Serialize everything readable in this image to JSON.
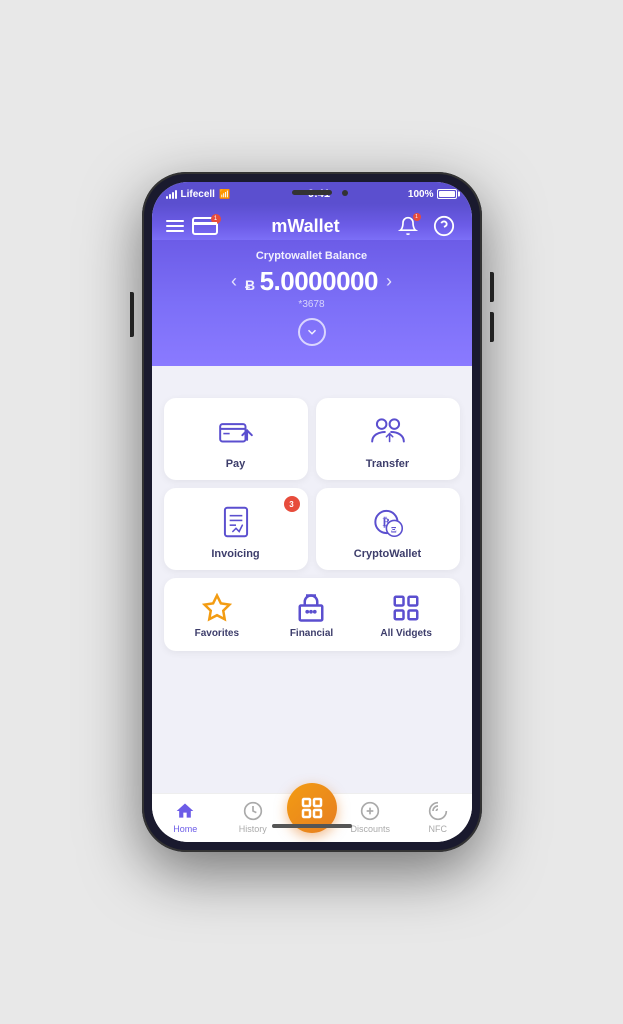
{
  "phone": {
    "status_bar": {
      "carrier": "Lifecell",
      "time": "9:41",
      "battery": "100%"
    },
    "header": {
      "title": "mWallet",
      "notifications_count": "1"
    },
    "balance": {
      "label": "Cryptowallet Balance",
      "currency_symbol": "Ƀ",
      "amount": "5.0000000",
      "account": "*3678"
    },
    "services": [
      {
        "id": "pay",
        "label": "Pay",
        "badge": null
      },
      {
        "id": "transfer",
        "label": "Transfer",
        "badge": null
      },
      {
        "id": "invoicing",
        "label": "Invoicing",
        "badge": "3"
      },
      {
        "id": "cryptowallet",
        "label": "CryptoWallet",
        "badge": null
      }
    ],
    "widgets": [
      {
        "id": "favorites",
        "label": "Favorites"
      },
      {
        "id": "financial",
        "label": "Financial"
      },
      {
        "id": "all-widgets",
        "label": "All Vidgets"
      }
    ],
    "bottom_nav": [
      {
        "id": "home",
        "label": "Home",
        "active": true
      },
      {
        "id": "history",
        "label": "History",
        "active": false
      },
      {
        "id": "scan",
        "label": "",
        "active": false,
        "center": true
      },
      {
        "id": "discounts",
        "label": "Discounts",
        "active": false
      },
      {
        "id": "nfc",
        "label": "NFC",
        "active": false
      }
    ]
  }
}
